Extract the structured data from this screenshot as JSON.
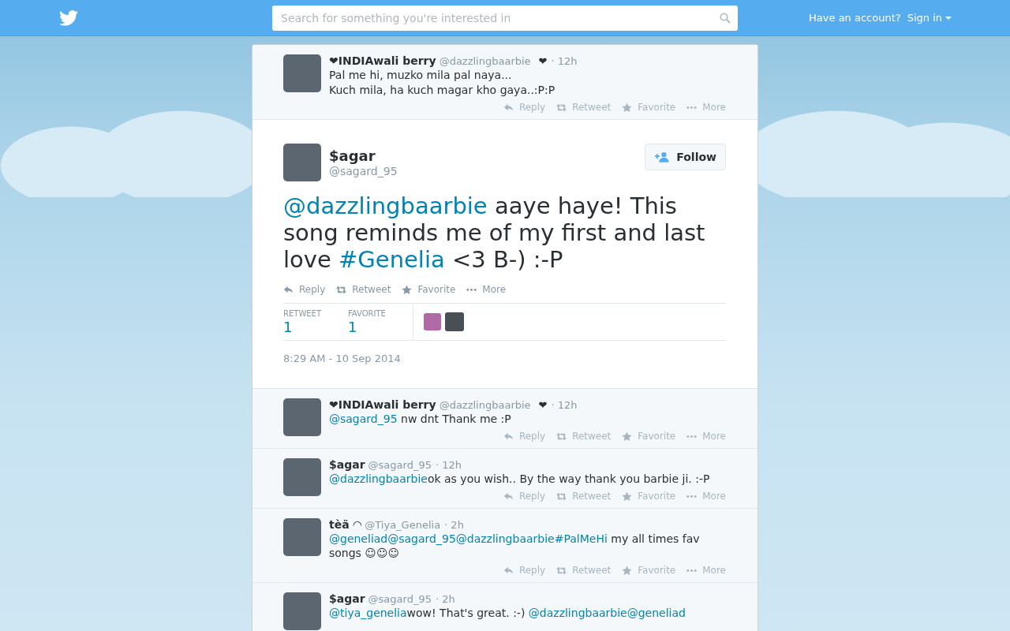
{
  "header": {
    "search": {
      "placeholder": "Search for something you're interested in"
    },
    "account_prompt": "Have an account?",
    "sign_in": "Sign in"
  },
  "before": [
    {
      "name": "❤INDIAwali berry",
      "handle": "@dazzlingbaarbie",
      "extra": "❤",
      "time": "· 12h",
      "lines": [
        [
          {
            "kind": "text",
            "text": "Pal me hi, muzko mila pal naya..."
          }
        ],
        [
          {
            "kind": "text",
            "text": "Kuch mila, ha kuch magar kho gaya..:P:P"
          }
        ]
      ],
      "actions": [
        {
          "kind": "reply",
          "label": "Reply"
        },
        {
          "kind": "retweet",
          "label": "Retweet"
        },
        {
          "kind": "favorite",
          "label": "Favorite"
        },
        {
          "kind": "more",
          "label": "More"
        }
      ]
    }
  ],
  "main": {
    "name": "$agar",
    "handle": "@sagard_95",
    "follow": "Follow",
    "text": [
      {
        "kind": "mention",
        "text": "@dazzlingbaarbie"
      },
      {
        "kind": "text",
        "text": " aaye haye! This song reminds me of my first and last love "
      },
      {
        "kind": "hashtag",
        "text": "#Genelia"
      },
      {
        "kind": "text",
        "text": " <3 B-) :-P"
      }
    ],
    "actions": [
      {
        "kind": "reply",
        "label": "Reply"
      },
      {
        "kind": "retweet",
        "label": "Retweet"
      },
      {
        "kind": "favorite",
        "label": "Favorite"
      },
      {
        "kind": "more",
        "label": "More"
      }
    ],
    "stats": [
      {
        "label": "RETWEET",
        "value": "1"
      },
      {
        "label": "FAVORITE",
        "value": "1"
      }
    ],
    "timestamp": "8:29 AM - 10 Sep 2014"
  },
  "replies": [
    {
      "name": "❤INDIAwali berry",
      "handle": "@dazzlingbaarbie",
      "extra": "❤",
      "time": "· 12h",
      "lines": [
        [
          {
            "kind": "mention",
            "text": "@sagard_95"
          },
          {
            "kind": "text",
            "text": " nw dnt Thank me :P"
          }
        ]
      ],
      "actions": [
        {
          "kind": "reply",
          "label": "Reply"
        },
        {
          "kind": "retweet",
          "label": "Retweet"
        },
        {
          "kind": "favorite",
          "label": "Favorite"
        },
        {
          "kind": "more",
          "label": "More"
        }
      ]
    },
    {
      "name": "$agar",
      "handle": "@sagard_95",
      "time": "· 12h",
      "lines": [
        [
          {
            "kind": "mention",
            "text": "@dazzlingbaarbie"
          },
          {
            "kind": "text",
            "text": "ok as you wish.. By the way thank you barbie ji. :-P"
          }
        ]
      ],
      "actions": [
        {
          "kind": "reply",
          "label": "Reply"
        },
        {
          "kind": "retweet",
          "label": "Retweet"
        },
        {
          "kind": "favorite",
          "label": "Favorite"
        },
        {
          "kind": "more",
          "label": "More"
        }
      ]
    },
    {
      "name": "tèä ◠",
      "handle": "@Tiya_Genelia",
      "time": "· 2h",
      "lines": [
        [
          {
            "kind": "mention",
            "text": "@geneliad"
          },
          {
            "kind": "mention",
            "text": "@sagard_95"
          },
          {
            "kind": "mention",
            "text": "@dazzlingbaarbie"
          },
          {
            "kind": "hashtag",
            "text": "#PalMeHi"
          },
          {
            "kind": "text",
            "text": " my all times fav songs ☺☺☺"
          }
        ]
      ],
      "actions": [
        {
          "kind": "reply",
          "label": "Reply"
        },
        {
          "kind": "retweet",
          "label": "Retweet"
        },
        {
          "kind": "favorite",
          "label": "Favorite"
        },
        {
          "kind": "more",
          "label": "More"
        }
      ]
    },
    {
      "name": "$agar",
      "handle": "@sagard_95",
      "time": "· 2h",
      "lines": [
        [
          {
            "kind": "mention",
            "text": "@tiya_genelia"
          },
          {
            "kind": "text",
            "text": "wow! That's great. :-) "
          },
          {
            "kind": "mention",
            "text": "@dazzlingbaarbie"
          },
          {
            "kind": "mention",
            "text": "@geneliad"
          }
        ]
      ]
    }
  ]
}
